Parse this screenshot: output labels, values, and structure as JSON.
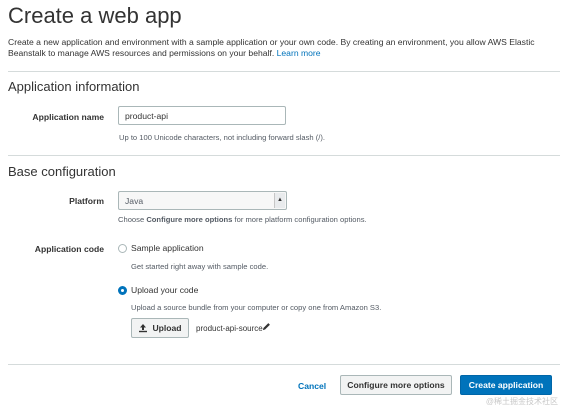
{
  "page": {
    "title": "Create a web app",
    "intro_text": "Create a new application and environment with a sample application or your own code. By creating an environment, you allow AWS Elastic Beanstalk to manage AWS resources and permissions on your behalf.",
    "learn_more": "Learn more"
  },
  "application_information": {
    "heading": "Application information",
    "name_label": "Application name",
    "name_value": "product-api",
    "name_hint": "Up to 100 Unicode characters, not including forward slash (/)."
  },
  "base_configuration": {
    "heading": "Base configuration",
    "platform_label": "Platform",
    "platform_value": "Java",
    "platform_hint_prefix": "Choose",
    "platform_hint_bold": "Configure more options",
    "platform_hint_suffix": "for more platform configuration options.",
    "code_label": "Application code",
    "options": [
      {
        "label": "Sample application",
        "hint": "Get started right away with sample code.",
        "selected": false
      },
      {
        "label": "Upload your code",
        "hint": "Upload a source bundle from your computer or copy one from Amazon S3.",
        "selected": true
      }
    ],
    "upload_button": "Upload",
    "uploaded_file": "product-api-source"
  },
  "footer": {
    "cancel": "Cancel",
    "configure_more": "Configure more options",
    "create": "Create application"
  },
  "watermark": "@稀土掘金技术社区",
  "colors": {
    "accent": "#0073bb",
    "divider": "#d5dbdb"
  }
}
